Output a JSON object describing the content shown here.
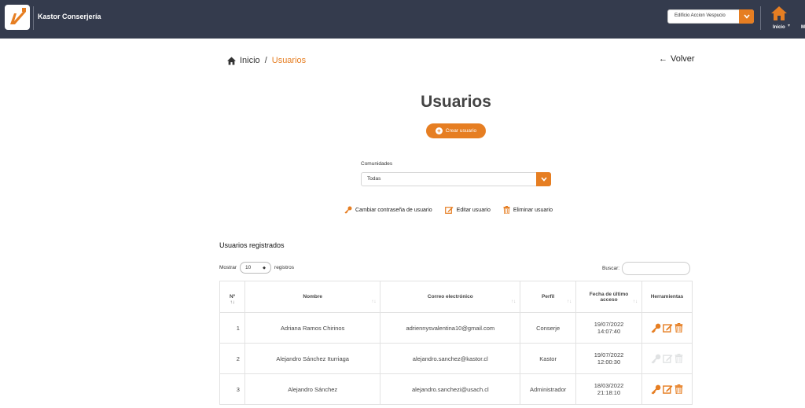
{
  "header": {
    "brand": "Kastor Conserjería",
    "building_select": "Edificio Accion Vespucio",
    "nav_home": "Inicio",
    "nav_next": "M"
  },
  "breadcrumb": {
    "home": "Inicio",
    "separator": "/",
    "current": "Usuarios"
  },
  "back_label": "Volver",
  "page_title": "Usuarios",
  "create_button": "Crear usuario",
  "filter": {
    "label": "Comunidades",
    "value": "Todas"
  },
  "legend": {
    "change_password": "Cambiar contraseña de usuario",
    "edit": "Editar usuario",
    "delete": "Eliminar usuario"
  },
  "section_title": "Usuarios registrados",
  "length": {
    "prefix": "Mostrar",
    "value": "10",
    "suffix": "registros"
  },
  "search_label": "Buscar:",
  "table": {
    "headers": [
      "Nº",
      "Nombre",
      "Correo electrónico",
      "Perfil",
      "Fecha de último acceso",
      "Herramientas"
    ],
    "rows": [
      {
        "n": "1",
        "name": "Adriana Ramos Chirinos",
        "email": "adriennysvalentina10@gmail.com",
        "profile": "Conserje",
        "date": "19/07/2022",
        "time": "14:07:40",
        "tools_enabled": true
      },
      {
        "n": "2",
        "name": "Alejandro Sánchez Iturriaga",
        "email": "alejandro.sanchez@kastor.cl",
        "profile": "Kastor",
        "date": "19/07/2022",
        "time": "12:00:30",
        "tools_enabled": false
      },
      {
        "n": "3",
        "name": "Alejandro Sánchez",
        "email": "alejandro.sanchezi@usach.cl",
        "profile": "Administrador",
        "date": "18/03/2022",
        "time": "21:18:10",
        "tools_enabled": true
      }
    ]
  },
  "colors": {
    "topbar": "#343b4d",
    "accent": "#e67e22"
  }
}
